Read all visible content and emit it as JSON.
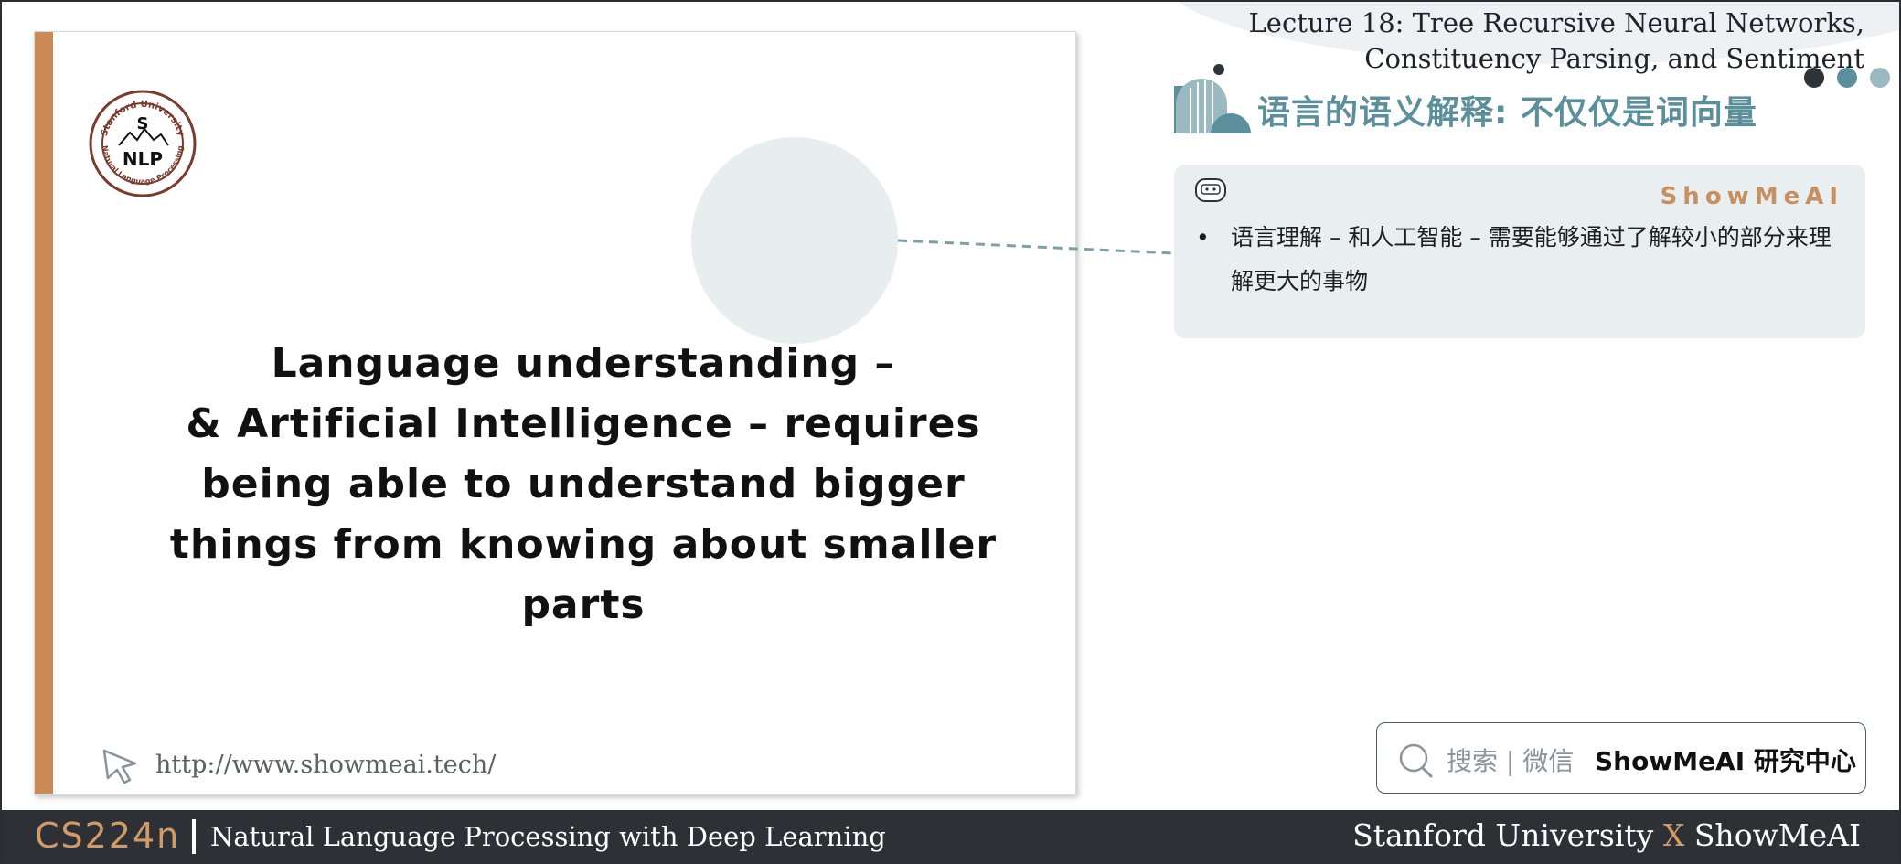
{
  "header": {
    "lecture_title_line1": "Lecture 18: Tree Recursive Neural Networks,",
    "lecture_title_line2": "Constituency Parsing, and Sentiment",
    "section_title": "语言的语义解释: 不仅仅是词向量",
    "dot_colors": [
      "#2d3338",
      "#5b8f9b",
      "#9bb9c0"
    ]
  },
  "note": {
    "brand": "ShowMeAI",
    "bullet": "•",
    "text": "语言理解 – 和人工智能 – 需要能够通过了解较小的部分来理解更大的事物"
  },
  "slide": {
    "logo_top": "Stanford University",
    "logo_s": "S",
    "logo_nlp": "NLP",
    "logo_bottom": "Natural Language Processing",
    "quote_lines": [
      "Language understanding –",
      "& Artificial Intelligence – requires",
      "being able to understand bigger",
      "things from knowing about smaller",
      "parts"
    ],
    "url": "http://www.showmeai.tech/",
    "accent_color": "#c98a55"
  },
  "search": {
    "label": "搜索 | 微信",
    "brand": "ShowMeAI 研究中心"
  },
  "footer": {
    "course_code": "CS224n",
    "course_name": "Natural Language Processing with Deep Learning",
    "credit_left": "Stanford University",
    "credit_x": "X",
    "credit_right": "ShowMeAI"
  }
}
